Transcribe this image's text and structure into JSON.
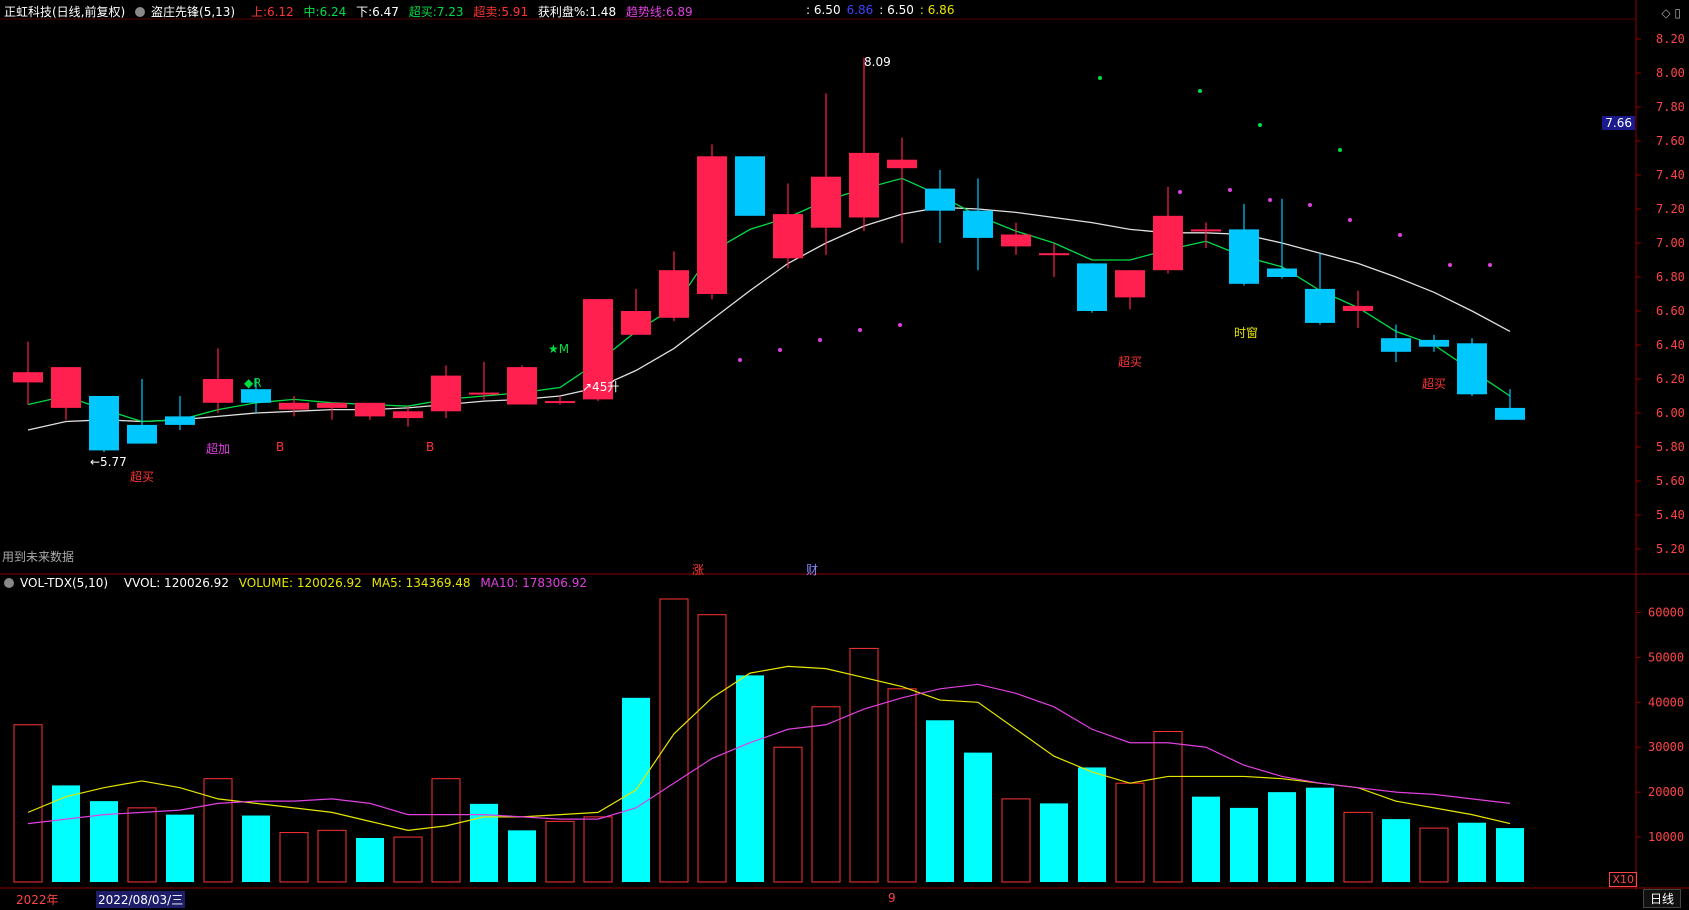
{
  "header": {
    "title": "正虹科技(日线,前复权)",
    "indicator": "盗庄先锋(5,13)",
    "up_label": "上:",
    "up_val": "6.12",
    "mid_label": "中:",
    "mid_val": "6.24",
    "down_label": "下:",
    "down_val": "6.47",
    "overbuy_label": "超买:",
    "overbuy_val": "7.23",
    "oversell_label": "超卖:",
    "oversell_val": "5.91",
    "profit_label": "获利盘%:",
    "profit_val": "1.48",
    "trend_label": "趋势线:",
    "trend_val": "6.89",
    "extra1": ": 6.50",
    "extra2": "6.86",
    "extra3": ": 6.50",
    "extra4": ": 6.86"
  },
  "volume_header": {
    "name": "VOL-TDX(5,10)",
    "vvol": "VVOL: 120026.92",
    "volume": "VOLUME: 120026.92",
    "ma5": "MA5: 134369.48",
    "ma10": "MA10: 178306.92"
  },
  "annotations": {
    "low": "←5.77",
    "high": "8.09",
    "future_data": "用到未来数据",
    "zhang": "涨",
    "cai": "财",
    "r_mark": "◆R",
    "m_mark": "★M",
    "up45": "↗45升",
    "chaomai": "超买",
    "jiajia": "超加",
    "b": "B",
    "shichuang": "时窗",
    "current_price": "7.66"
  },
  "bottom": {
    "year": "2022年",
    "date": "2022/08/03/三",
    "nine": "9",
    "x10": "X10",
    "period": "日线"
  },
  "colors": {
    "up": "#ff2050",
    "down": "#00c8ff",
    "ma_white": "#e0e0e0",
    "ma_green": "#00dd44",
    "vol_up": "#00ffff",
    "vol_down": "#ff3333",
    "ma5": "#e6e600",
    "ma10": "#e040e0"
  },
  "chart_data": [
    {
      "type": "candlestick",
      "title": "正虹科技(日线,前复权)",
      "ylim": [
        5.1,
        8.3
      ],
      "yticks": [
        "8.20",
        "8.00",
        "7.80",
        "7.60",
        "7.40",
        "7.20",
        "7.00",
        "6.80",
        "6.60",
        "6.40",
        "6.20",
        "6.00",
        "5.80",
        "5.60",
        "5.40",
        "5.20"
      ],
      "ohlc": [
        [
          6.18,
          6.42,
          6.05,
          6.24
        ],
        [
          6.03,
          6.27,
          5.96,
          6.27
        ],
        [
          6.1,
          6.1,
          5.77,
          5.78
        ],
        [
          5.93,
          6.2,
          5.82,
          5.82
        ],
        [
          5.98,
          6.1,
          5.9,
          5.93
        ],
        [
          6.06,
          6.38,
          6.0,
          6.2
        ],
        [
          6.14,
          6.2,
          6.0,
          6.06
        ],
        [
          6.02,
          6.1,
          5.98,
          6.06
        ],
        [
          6.03,
          6.06,
          5.96,
          6.06
        ],
        [
          5.98,
          6.05,
          5.96,
          6.06
        ],
        [
          5.97,
          6.04,
          5.92,
          6.01
        ],
        [
          6.01,
          6.28,
          5.97,
          6.22
        ],
        [
          6.12,
          6.3,
          6.08,
          6.12
        ],
        [
          6.05,
          6.28,
          6.05,
          6.27
        ],
        [
          6.06,
          6.1,
          6.05,
          6.07
        ],
        [
          6.08,
          6.67,
          6.07,
          6.67
        ],
        [
          6.46,
          6.73,
          6.46,
          6.6
        ],
        [
          6.56,
          6.95,
          6.54,
          6.84
        ],
        [
          6.7,
          7.58,
          6.67,
          7.51
        ],
        [
          7.51,
          7.51,
          7.24,
          7.16
        ],
        [
          6.91,
          7.35,
          6.85,
          7.17
        ],
        [
          7.09,
          7.88,
          6.93,
          7.39
        ],
        [
          7.15,
          8.09,
          7.07,
          7.53
        ],
        [
          7.44,
          7.62,
          7.0,
          7.49
        ],
        [
          7.32,
          7.43,
          7.0,
          7.19
        ],
        [
          7.19,
          7.38,
          6.84,
          7.03
        ],
        [
          6.98,
          7.12,
          6.93,
          7.05
        ],
        [
          6.94,
          7.0,
          6.8,
          6.94
        ],
        [
          6.88,
          6.88,
          6.59,
          6.6
        ],
        [
          6.68,
          6.84,
          6.61,
          6.84
        ],
        [
          6.84,
          7.33,
          6.82,
          7.16
        ],
        [
          7.07,
          7.12,
          6.97,
          7.08
        ],
        [
          7.08,
          7.23,
          6.75,
          6.76
        ],
        [
          6.85,
          7.26,
          6.79,
          6.8
        ],
        [
          6.73,
          6.94,
          6.52,
          6.53
        ],
        [
          6.6,
          6.72,
          6.5,
          6.63
        ],
        [
          6.44,
          6.52,
          6.3,
          6.36
        ],
        [
          6.43,
          6.46,
          6.36,
          6.39
        ],
        [
          6.41,
          6.44,
          6.1,
          6.11
        ],
        [
          6.03,
          6.14,
          5.96,
          5.96
        ]
      ],
      "series": [
        {
          "name": "white_ma",
          "values": [
            5.9,
            5.95,
            5.96,
            5.95,
            5.96,
            5.98,
            6.0,
            6.01,
            6.02,
            6.02,
            6.03,
            6.05,
            6.07,
            6.08,
            6.1,
            6.15,
            6.25,
            6.38,
            6.55,
            6.72,
            6.88,
            7.0,
            7.1,
            7.17,
            7.21,
            7.2,
            7.18,
            7.15,
            7.12,
            7.08,
            7.06,
            7.06,
            7.05,
            7.0,
            6.94,
            6.88,
            6.8,
            6.71,
            6.6,
            6.48
          ]
        },
        {
          "name": "green_ma",
          "values": [
            6.05,
            6.1,
            6.02,
            5.95,
            5.96,
            6.02,
            6.06,
            6.08,
            6.06,
            6.05,
            6.04,
            6.08,
            6.1,
            6.12,
            6.15,
            6.3,
            6.48,
            6.62,
            6.95,
            7.08,
            7.15,
            7.25,
            7.32,
            7.38,
            7.28,
            7.16,
            7.07,
            7.0,
            6.9,
            6.9,
            6.96,
            7.01,
            6.92,
            6.86,
            6.72,
            6.62,
            6.48,
            6.4,
            6.25,
            6.1
          ]
        }
      ]
    },
    {
      "type": "bar",
      "title": "VOL-TDX(5,10)",
      "ylim": [
        0,
        65000
      ],
      "yticks": [
        "60000",
        "50000",
        "40000",
        "30000",
        "20000",
        "10000"
      ],
      "values": [
        35000,
        21500,
        18000,
        16500,
        15000,
        23000,
        14800,
        11000,
        11500,
        9800,
        10000,
        23000,
        17400,
        11500,
        13500,
        14500,
        41000,
        63000,
        59500,
        46000,
        30000,
        39000,
        52000,
        43000,
        36000,
        28800,
        18500,
        17500,
        25500,
        22000,
        33500,
        19000,
        16500,
        20000,
        21000,
        15500,
        14000,
        12000,
        13200,
        12000
      ],
      "direction": [
        "d",
        "u",
        "u",
        "d",
        "u",
        "d",
        "u",
        "d",
        "d",
        "u",
        "d",
        "d",
        "u",
        "u",
        "d",
        "d",
        "u",
        "d",
        "d",
        "u",
        "d",
        "d",
        "d",
        "d",
        "u",
        "u",
        "d",
        "u",
        "u",
        "d",
        "d",
        "u",
        "u",
        "u",
        "u",
        "d",
        "u",
        "d",
        "u",
        "u"
      ],
      "series": [
        {
          "name": "MA5",
          "values": [
            15500,
            19000,
            21000,
            22500,
            21000,
            18500,
            17500,
            16500,
            15500,
            13500,
            11500,
            12500,
            14500,
            14500,
            15000,
            15500,
            20500,
            33000,
            41000,
            46500,
            48000,
            47500,
            45500,
            43500,
            40500,
            40000,
            34000,
            28000,
            24500,
            22000,
            23500,
            23500,
            23500,
            23000,
            22000,
            21000,
            18000,
            16500,
            15000,
            13000
          ]
        },
        {
          "name": "MA10",
          "values": [
            13000,
            14000,
            15000,
            15500,
            16000,
            17500,
            18000,
            18000,
            18500,
            17500,
            15000,
            15000,
            15000,
            14500,
            14000,
            14000,
            16500,
            22000,
            27500,
            31000,
            34000,
            35000,
            38500,
            41000,
            43000,
            44000,
            42000,
            39000,
            34000,
            31000,
            31000,
            30000,
            26000,
            23500,
            22000,
            21000,
            20000,
            19500,
            18500,
            17500
          ]
        }
      ]
    }
  ]
}
